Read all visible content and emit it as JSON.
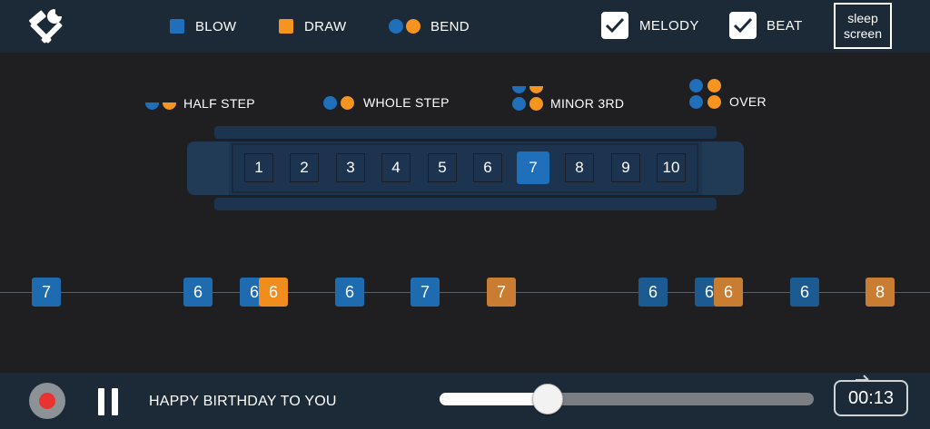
{
  "topbar": {
    "legend": [
      {
        "label": "BLOW",
        "color": "#1f6fba",
        "kind": "square"
      },
      {
        "label": "DRAW",
        "color": "#f5951f",
        "kind": "square"
      },
      {
        "label": "BEND",
        "colors": [
          "#1f6fba",
          "#f5951f"
        ],
        "kind": "dots"
      }
    ],
    "melody": {
      "label": "MELODY",
      "checked": true
    },
    "beat": {
      "label": "BEAT",
      "checked": true
    },
    "sleep_label_line1": "sleep",
    "sleep_label_line2": "screen"
  },
  "bend_legend": [
    {
      "label": "HALF STEP"
    },
    {
      "label": "WHOLE STEP"
    },
    {
      "label": "MINOR 3RD"
    },
    {
      "label": "OVER"
    }
  ],
  "harmonica": {
    "holes": [
      "1",
      "2",
      "3",
      "4",
      "5",
      "6",
      "7",
      "8",
      "9",
      "10"
    ],
    "active_hole": "7"
  },
  "track": {
    "notes": [
      {
        "label": "7",
        "type": "blow"
      },
      {
        "label": "6",
        "type": "blow"
      },
      {
        "label": "6",
        "type": "blow"
      },
      {
        "label": "6",
        "type": "draw"
      },
      {
        "label": "6",
        "type": "blow"
      },
      {
        "label": "7",
        "type": "blow"
      },
      {
        "label": "7",
        "type": "draw"
      },
      {
        "label": "6",
        "type": "blow"
      },
      {
        "label": "6",
        "type": "blow"
      },
      {
        "label": "6",
        "type": "draw"
      },
      {
        "label": "6",
        "type": "blow"
      },
      {
        "label": "8",
        "type": "draw"
      }
    ]
  },
  "player": {
    "song_title": "HAPPY BIRTHDAY TO YOU",
    "progress": 0.29,
    "time": "00:13"
  },
  "colors": {
    "blow": "#1f6fba",
    "draw": "#f5951f",
    "record": "#e8332f"
  },
  "icons": [
    "tools-icon",
    "check-icon",
    "record-icon",
    "pause-icon"
  ]
}
